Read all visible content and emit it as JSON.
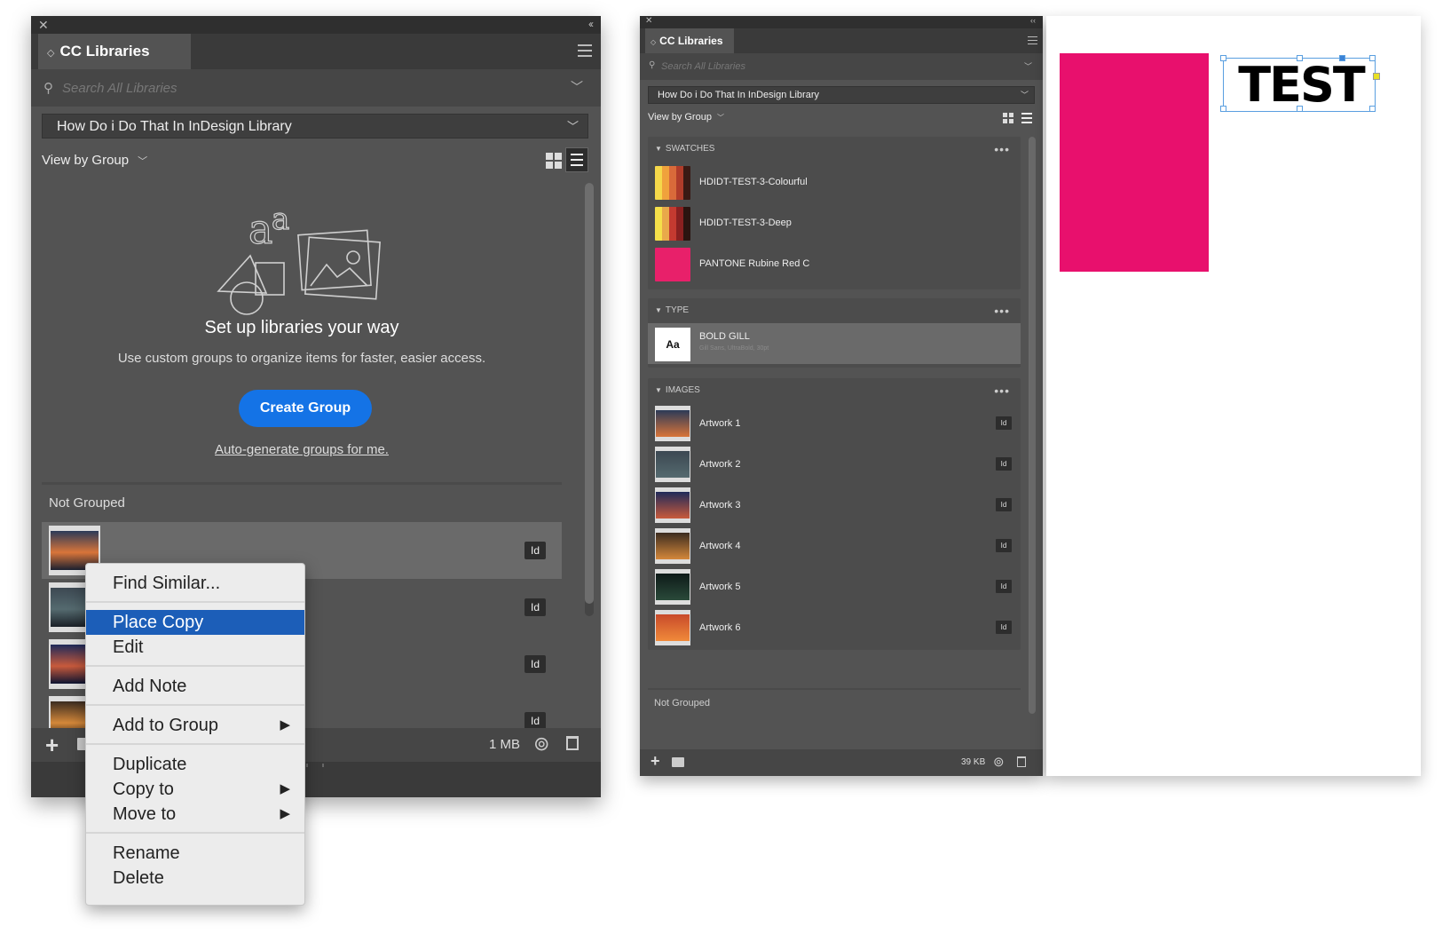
{
  "left_panel": {
    "tab_title": "CC Libraries",
    "search_placeholder": "Search All Libraries",
    "library_name": "How Do i Do That In InDesign Library",
    "view_by": "View by Group",
    "empty_state": {
      "title": "Set up libraries your way",
      "description": "Use custom groups to organize items for faster, easier access.",
      "create_group_label": "Create Group",
      "auto_generate_label": "Auto-generate groups for me."
    },
    "not_grouped_label": "Not Grouped",
    "items": [
      {
        "badge": "Id",
        "thumb": [
          "#ffffff",
          "#2b3a58",
          "#d9753a",
          "#1b2030"
        ]
      },
      {
        "badge": "Id",
        "thumb": [
          "#ffffff",
          "#3c4852",
          "#556a6f",
          "#1a2027"
        ]
      },
      {
        "badge": "Id",
        "thumb": [
          "#ffffff",
          "#1f2a5a",
          "#c85a3c",
          "#0d1432"
        ]
      },
      {
        "badge": "Id",
        "thumb": [
          "#ffffff",
          "#3b2c20",
          "#d4883a",
          "#120c08"
        ]
      }
    ],
    "footer": {
      "size": "1 MB"
    }
  },
  "context_menu": {
    "items": [
      {
        "label": "Find Similar...",
        "has_submenu": false
      },
      {
        "label": "Place Copy",
        "highlighted": true,
        "has_submenu": false
      },
      {
        "label": "Edit",
        "has_submenu": false
      },
      {
        "label": "Add Note",
        "has_submenu": false
      },
      {
        "label": "Add to Group",
        "has_submenu": true
      },
      {
        "label": "Duplicate",
        "has_submenu": false
      },
      {
        "label": "Copy to",
        "has_submenu": true
      },
      {
        "label": "Move to",
        "has_submenu": true
      },
      {
        "label": "Rename",
        "has_submenu": false
      },
      {
        "label": "Delete",
        "has_submenu": false
      }
    ],
    "submenu_arrow": "▶"
  },
  "right_panel": {
    "tab_title": "CC Libraries",
    "search_placeholder": "Search All Libraries",
    "library_name": "How Do i Do That In InDesign Library",
    "view_by": "View by Group",
    "groups": {
      "swatches": {
        "title": "SWATCHES",
        "items": [
          {
            "label": "HDIDT-TEST-3-Colourful",
            "colors": [
              "#f5d84a",
              "#f0a23c",
              "#d96a3a",
              "#b03c2a",
              "#3a1a14"
            ]
          },
          {
            "label": "HDIDT-TEST-3-Deep",
            "colors": [
              "#f5e04a",
              "#e9a94a",
              "#c43a30",
              "#8a2020",
              "#2a1410"
            ]
          },
          {
            "label": "PANTONE Rubine Red C",
            "colors": [
              "#e8206a"
            ]
          }
        ]
      },
      "type": {
        "title": "TYPE",
        "items": [
          {
            "label": "BOLD GILL",
            "sub": "Gill Sans, UltraBold, 30pt",
            "preview": "Aa"
          }
        ]
      },
      "images": {
        "title": "IMAGES",
        "items": [
          {
            "label": "Artwork 1",
            "badge": "Id",
            "thumb": [
              "#2b3a58",
              "#d9753a"
            ]
          },
          {
            "label": "Artwork 2",
            "badge": "Id",
            "thumb": [
              "#3c4852",
              "#556a6f"
            ]
          },
          {
            "label": "Artwork 3",
            "badge": "Id",
            "thumb": [
              "#1f2a5a",
              "#c85a3c"
            ]
          },
          {
            "label": "Artwork 4",
            "badge": "Id",
            "thumb": [
              "#3b2c20",
              "#d4883a"
            ]
          },
          {
            "label": "Artwork 5",
            "badge": "Id",
            "thumb": [
              "#0e1a18",
              "#2a4a3a"
            ]
          },
          {
            "label": "Artwork 6",
            "badge": "Id",
            "thumb": [
              "#c84a2a",
              "#f08a3a"
            ]
          }
        ]
      }
    },
    "not_grouped_label": "Not Grouped",
    "footer": {
      "size": "39 KB"
    }
  },
  "document": {
    "text_frame": "TEST",
    "rect_color": "#e8106d"
  },
  "colors": {
    "panel_bg": "#535353",
    "accent_blue": "#1473e6",
    "menu_highlight": "#1c5eb8"
  }
}
